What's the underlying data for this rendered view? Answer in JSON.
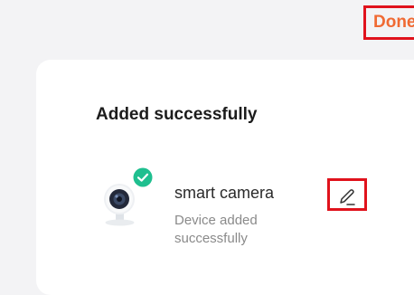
{
  "header": {
    "done_label": "Done"
  },
  "card": {
    "title": "Added successfully",
    "device": {
      "name": "smart camera",
      "status": "Device added successfully",
      "image_icon": "camera-icon",
      "badge_icon": "check-badge-icon",
      "edit_icon": "pencil-icon"
    }
  },
  "colors": {
    "accent": "#f06a33",
    "highlight_border": "#e0121c",
    "success": "#1fbf8f",
    "background": "#f3f3f5",
    "card": "#ffffff"
  }
}
